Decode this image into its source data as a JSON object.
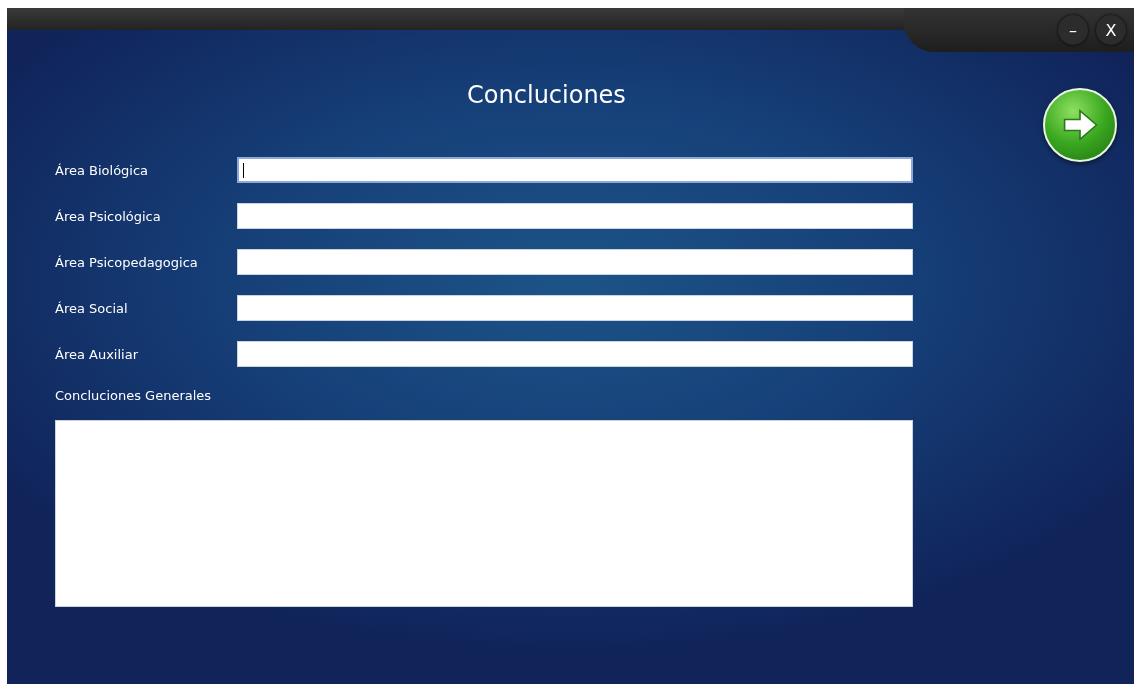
{
  "window": {
    "controls": [
      {
        "label": "–"
      },
      {
        "label": "X"
      }
    ]
  },
  "title": "Concluciones",
  "fields": [
    {
      "label": "Área Biológica",
      "focused": true
    },
    {
      "label": "Área Psicológica",
      "focused": false
    },
    {
      "label": "Área Psicopedagogica",
      "focused": false
    },
    {
      "label": "Área Social",
      "focused": false
    },
    {
      "label": "Área Auxiliar",
      "focused": false
    }
  ],
  "general": {
    "label": "Concluciones Generales"
  }
}
